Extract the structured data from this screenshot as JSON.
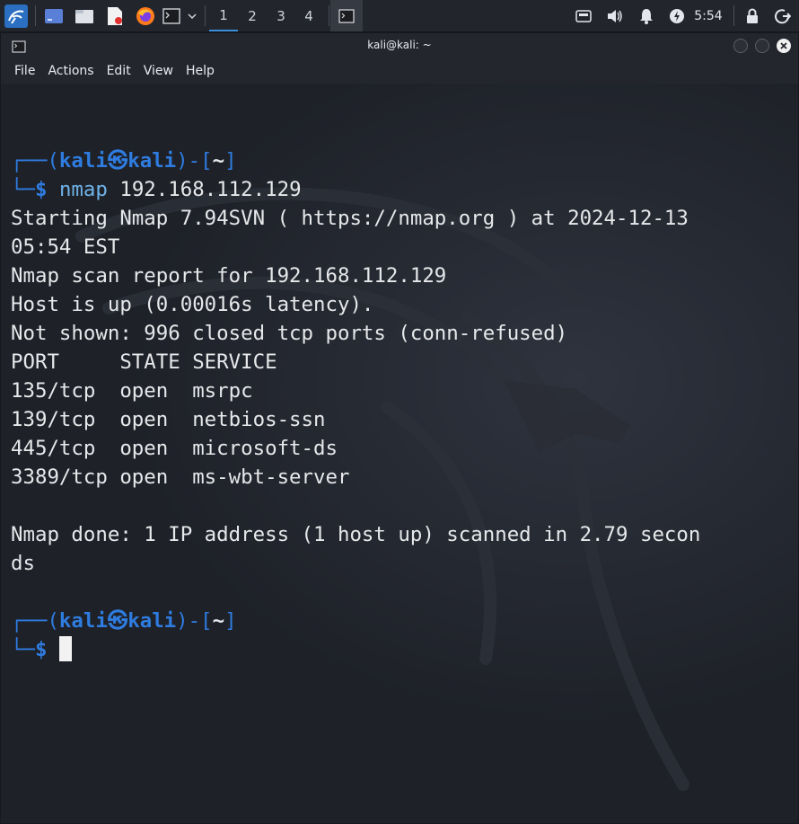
{
  "taskbar": {
    "workspaces": [
      "1",
      "2",
      "3",
      "4"
    ],
    "clock": "5:54",
    "icons": [
      "kali-menu-icon",
      "show-desktop-icon",
      "file-manager-icon",
      "text-editor-icon",
      "firefox-icon",
      "terminal-icon",
      "dropdown-chevron-icon",
      "terminal-task-icon",
      "screen-icon",
      "volume-icon",
      "notification-bell-icon",
      "power-icon",
      "lock-icon",
      "logout-icon"
    ]
  },
  "window": {
    "title": "kali@kali: ~",
    "menu": [
      "File",
      "Actions",
      "Edit",
      "View",
      "Help"
    ]
  },
  "terminal": {
    "prompt": {
      "open": "┌──(",
      "user": "kali",
      "at": "㉿",
      "host": "kali",
      "mid": ")-[",
      "dir": "~",
      "close": "]",
      "corner": "└─",
      "dollar": "$"
    },
    "command": "nmap",
    "command_args": " 192.168.112.129",
    "output": [
      "Starting Nmap 7.94SVN ( https://nmap.org ) at 2024-12-13",
      "05:54 EST",
      "Nmap scan report for 192.168.112.129",
      "Host is up (0.00016s latency).",
      "Not shown: 996 closed tcp ports (conn-refused)",
      "PORT     STATE SERVICE",
      "135/tcp  open  msrpc",
      "139/tcp  open  netbios-ssn",
      "445/tcp  open  microsoft-ds",
      "3389/tcp open  ms-wbt-server",
      "",
      "Nmap done: 1 IP address (1 host up) scanned in 2.79 secon",
      "ds"
    ]
  }
}
